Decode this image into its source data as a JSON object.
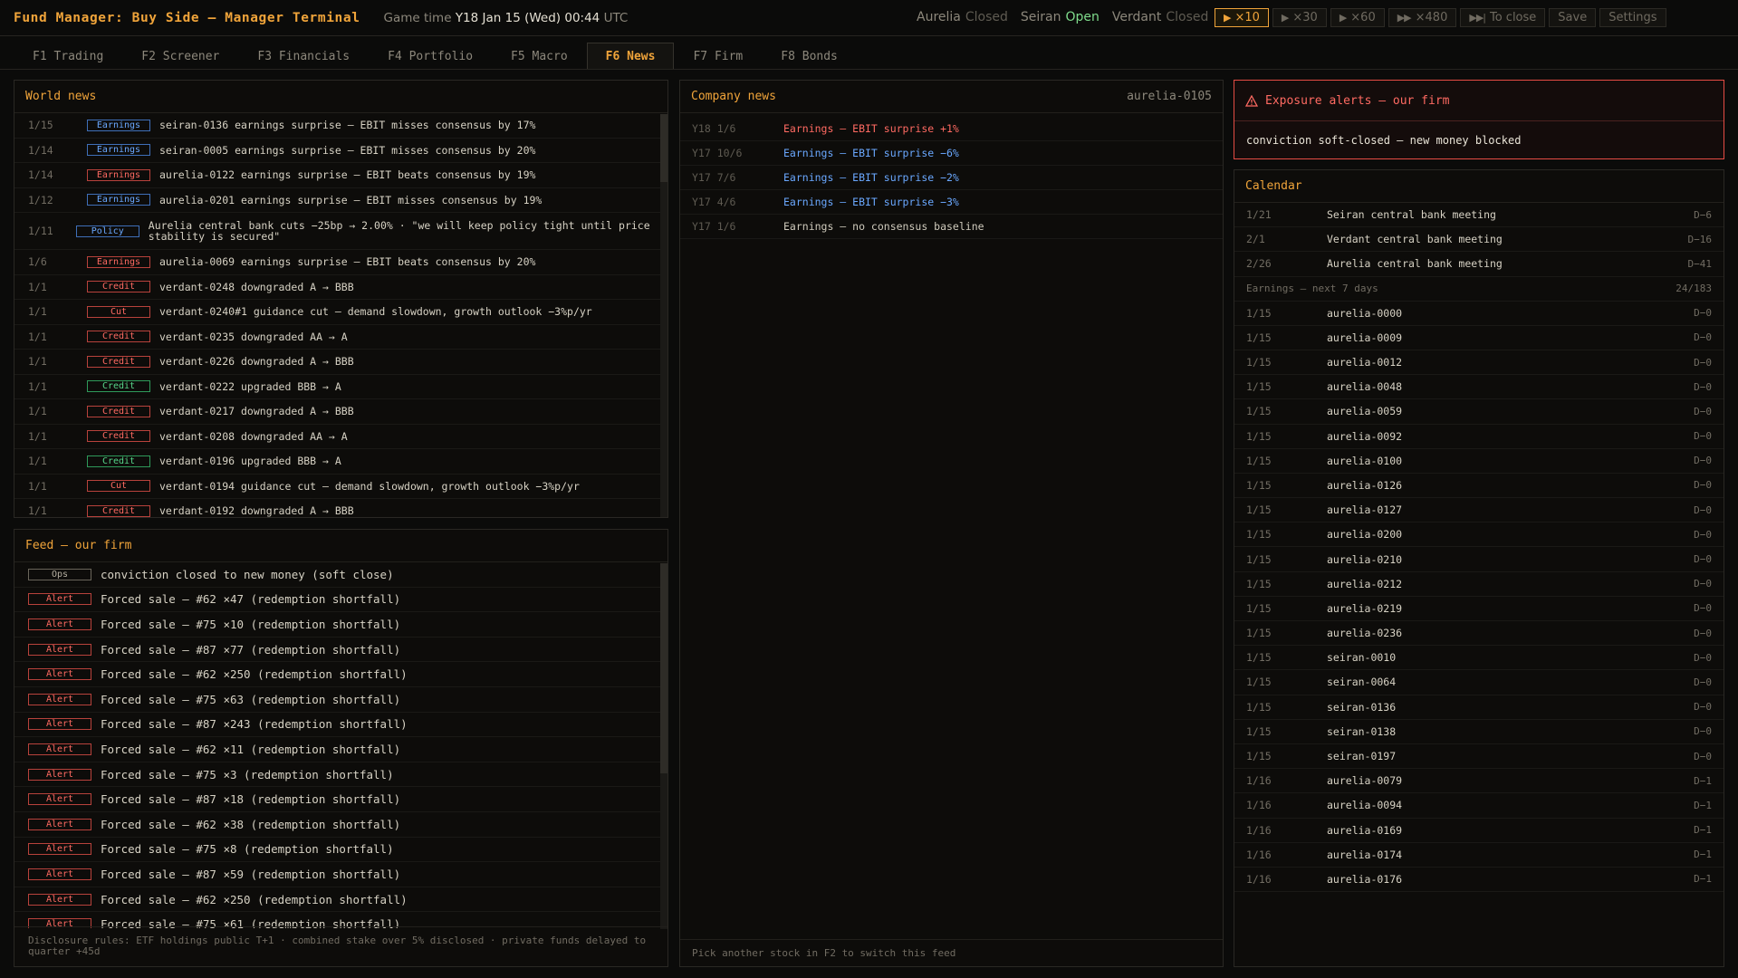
{
  "app": {
    "title": "Fund Manager: Buy Side — Manager Terminal"
  },
  "clock": {
    "label": "Game time",
    "value": "Y18 Jan 15 (Wed) 00:44",
    "tz": "UTC"
  },
  "markets": [
    {
      "name": "Aurelia",
      "status": "Closed",
      "state": "closed"
    },
    {
      "name": "Seiran",
      "status": "Open",
      "state": "open"
    },
    {
      "name": "Verdant",
      "status": "Closed",
      "state": "closed"
    }
  ],
  "speed": [
    {
      "icon": "play-icon",
      "glyph": "▶",
      "label": "×10",
      "active": true
    },
    {
      "icon": "play-icon",
      "glyph": "▶",
      "label": "×30",
      "active": false
    },
    {
      "icon": "play-icon",
      "glyph": "▶",
      "label": "×60",
      "active": false
    },
    {
      "icon": "fast-forward-icon",
      "glyph": "▶▶",
      "label": "×480",
      "active": false
    },
    {
      "icon": "skip-to-end-icon",
      "glyph": "▶▶|",
      "label": "To close",
      "active": false
    }
  ],
  "toolbar": {
    "save": "Save",
    "settings": "Settings"
  },
  "tabs": [
    {
      "key": "trading",
      "label": "F1 Trading",
      "active": false
    },
    {
      "key": "screener",
      "label": "F2 Screener",
      "active": false
    },
    {
      "key": "financials",
      "label": "F3 Financials",
      "active": false
    },
    {
      "key": "portfolio",
      "label": "F4 Portfolio",
      "active": false
    },
    {
      "key": "macro",
      "label": "F5 Macro",
      "active": false
    },
    {
      "key": "news",
      "label": "F6 News",
      "active": true
    },
    {
      "key": "firm",
      "label": "F7 Firm",
      "active": false
    },
    {
      "key": "bonds",
      "label": "F8 Bonds",
      "active": false
    }
  ],
  "world_news": {
    "title": "World news",
    "items": [
      {
        "date": "1/15",
        "tag": "Earnings",
        "tone": "earn",
        "text": "seiran-0136 earnings surprise — EBIT misses consensus by 17%"
      },
      {
        "date": "1/14",
        "tag": "Earnings",
        "tone": "earn",
        "text": "seiran-0005 earnings surprise — EBIT misses consensus by 20%"
      },
      {
        "date": "1/14",
        "tag": "Earnings",
        "tone": "earn-r",
        "text": "aurelia-0122 earnings surprise — EBIT beats consensus by 19%"
      },
      {
        "date": "1/12",
        "tag": "Earnings",
        "tone": "earn",
        "text": "aurelia-0201 earnings surprise — EBIT misses consensus by 19%"
      },
      {
        "date": "1/11",
        "tag": "Policy",
        "tone": "policy",
        "text": "Aurelia central bank cuts −25bp → 2.00% · \"we will keep policy tight until price stability is secured\"",
        "tall": true
      },
      {
        "date": "1/6",
        "tag": "Earnings",
        "tone": "earn-r",
        "text": "aurelia-0069 earnings surprise — EBIT beats consensus by 20%"
      },
      {
        "date": "1/1",
        "tag": "Credit",
        "tone": "credit-r",
        "text": "verdant-0248 downgraded A → BBB"
      },
      {
        "date": "1/1",
        "tag": "Cut",
        "tone": "cut",
        "text": "verdant-0240#1 guidance cut — demand slowdown, growth outlook −3%p/yr"
      },
      {
        "date": "1/1",
        "tag": "Credit",
        "tone": "credit-r",
        "text": "verdant-0235 downgraded AA → A"
      },
      {
        "date": "1/1",
        "tag": "Credit",
        "tone": "credit-r",
        "text": "verdant-0226 downgraded A → BBB"
      },
      {
        "date": "1/1",
        "tag": "Credit",
        "tone": "credit-g",
        "text": "verdant-0222 upgraded BBB → A"
      },
      {
        "date": "1/1",
        "tag": "Credit",
        "tone": "credit-r",
        "text": "verdant-0217 downgraded A → BBB"
      },
      {
        "date": "1/1",
        "tag": "Credit",
        "tone": "credit-r",
        "text": "verdant-0208 downgraded AA → A"
      },
      {
        "date": "1/1",
        "tag": "Credit",
        "tone": "credit-g",
        "text": "verdant-0196 upgraded BBB → A"
      },
      {
        "date": "1/1",
        "tag": "Cut",
        "tone": "cut",
        "text": "verdant-0194 guidance cut — demand slowdown, growth outlook −3%p/yr"
      },
      {
        "date": "1/1",
        "tag": "Credit",
        "tone": "credit-r",
        "text": "verdant-0192 downgraded A → BBB"
      }
    ]
  },
  "feed": {
    "title": "Feed — our firm",
    "items": [
      {
        "tag": "Ops",
        "tone": "ops",
        "text": "conviction closed to new money (soft close)"
      },
      {
        "tag": "Alert",
        "tone": "alert",
        "text": "Forced sale — #62 ×47 (redemption shortfall)"
      },
      {
        "tag": "Alert",
        "tone": "alert",
        "text": "Forced sale — #75 ×10 (redemption shortfall)"
      },
      {
        "tag": "Alert",
        "tone": "alert",
        "text": "Forced sale — #87 ×77 (redemption shortfall)"
      },
      {
        "tag": "Alert",
        "tone": "alert",
        "text": "Forced sale — #62 ×250 (redemption shortfall)"
      },
      {
        "tag": "Alert",
        "tone": "alert",
        "text": "Forced sale — #75 ×63 (redemption shortfall)"
      },
      {
        "tag": "Alert",
        "tone": "alert",
        "text": "Forced sale — #87 ×243 (redemption shortfall)"
      },
      {
        "tag": "Alert",
        "tone": "alert",
        "text": "Forced sale — #62 ×11 (redemption shortfall)"
      },
      {
        "tag": "Alert",
        "tone": "alert",
        "text": "Forced sale — #75 ×3 (redemption shortfall)"
      },
      {
        "tag": "Alert",
        "tone": "alert",
        "text": "Forced sale — #87 ×18 (redemption shortfall)"
      },
      {
        "tag": "Alert",
        "tone": "alert",
        "text": "Forced sale — #62 ×38 (redemption shortfall)"
      },
      {
        "tag": "Alert",
        "tone": "alert",
        "text": "Forced sale — #75 ×8 (redemption shortfall)"
      },
      {
        "tag": "Alert",
        "tone": "alert",
        "text": "Forced sale — #87 ×59 (redemption shortfall)"
      },
      {
        "tag": "Alert",
        "tone": "alert",
        "text": "Forced sale — #62 ×250 (redemption shortfall)"
      },
      {
        "tag": "Alert",
        "tone": "alert",
        "text": "Forced sale — #75 ×61 (redemption shortfall)"
      }
    ],
    "disclosure": "Disclosure rules: ETF holdings public T+1 · combined stake over 5% disclosed · private funds delayed to quarter +45d"
  },
  "company_news": {
    "title": "Company news",
    "ticker": "aurelia-0105",
    "items": [
      {
        "date": "Y18 1/6",
        "text": "Earnings — EBIT surprise +1%",
        "tone": "red"
      },
      {
        "date": "Y17 10/6",
        "text": "Earnings — EBIT surprise −6%",
        "tone": "blue"
      },
      {
        "date": "Y17 7/6",
        "text": "Earnings — EBIT surprise −2%",
        "tone": "blue"
      },
      {
        "date": "Y17 4/6",
        "text": "Earnings — EBIT surprise −3%",
        "tone": "blue"
      },
      {
        "date": "Y17 1/6",
        "text": "Earnings — no consensus baseline",
        "tone": "grey"
      }
    ],
    "footer": "Pick another stock in F2 to switch this feed"
  },
  "alerts": {
    "title": "Exposure alerts — our firm",
    "icon": "warning-icon",
    "message": "conviction soft-closed — new money blocked"
  },
  "calendar": {
    "title": "Calendar",
    "events": [
      {
        "date": "1/21",
        "name": "Seiran central bank meeting",
        "days": "D−6"
      },
      {
        "date": "2/1",
        "name": "Verdant central bank meeting",
        "days": "D−16"
      },
      {
        "date": "2/26",
        "name": "Aurelia central bank meeting",
        "days": "D−41"
      }
    ],
    "earnings_label": "Earnings — next 7 days",
    "earnings_count": "24/183",
    "earnings": [
      {
        "date": "1/15",
        "name": "aurelia-0000",
        "days": "D−0"
      },
      {
        "date": "1/15",
        "name": "aurelia-0009",
        "days": "D−0"
      },
      {
        "date": "1/15",
        "name": "aurelia-0012",
        "days": "D−0"
      },
      {
        "date": "1/15",
        "name": "aurelia-0048",
        "days": "D−0"
      },
      {
        "date": "1/15",
        "name": "aurelia-0059",
        "days": "D−0"
      },
      {
        "date": "1/15",
        "name": "aurelia-0092",
        "days": "D−0"
      },
      {
        "date": "1/15",
        "name": "aurelia-0100",
        "days": "D−0"
      },
      {
        "date": "1/15",
        "name": "aurelia-0126",
        "days": "D−0"
      },
      {
        "date": "1/15",
        "name": "aurelia-0127",
        "days": "D−0"
      },
      {
        "date": "1/15",
        "name": "aurelia-0200",
        "days": "D−0"
      },
      {
        "date": "1/15",
        "name": "aurelia-0210",
        "days": "D−0"
      },
      {
        "date": "1/15",
        "name": "aurelia-0212",
        "days": "D−0"
      },
      {
        "date": "1/15",
        "name": "aurelia-0219",
        "days": "D−0"
      },
      {
        "date": "1/15",
        "name": "aurelia-0236",
        "days": "D−0"
      },
      {
        "date": "1/15",
        "name": "seiran-0010",
        "days": "D−0"
      },
      {
        "date": "1/15",
        "name": "seiran-0064",
        "days": "D−0"
      },
      {
        "date": "1/15",
        "name": "seiran-0136",
        "days": "D−0"
      },
      {
        "date": "1/15",
        "name": "seiran-0138",
        "days": "D−0"
      },
      {
        "date": "1/15",
        "name": "seiran-0197",
        "days": "D−0"
      },
      {
        "date": "1/16",
        "name": "aurelia-0079",
        "days": "D−1"
      },
      {
        "date": "1/16",
        "name": "aurelia-0094",
        "days": "D−1"
      },
      {
        "date": "1/16",
        "name": "aurelia-0169",
        "days": "D−1"
      },
      {
        "date": "1/16",
        "name": "aurelia-0174",
        "days": "D−1"
      },
      {
        "date": "1/16",
        "name": "aurelia-0176",
        "days": "D−1"
      }
    ]
  },
  "colors": {
    "accent": "#f0a43a",
    "alert": "#ff6a62",
    "up": "#57d68a",
    "down_blue": "#6aa8ff",
    "open": "#7fdc8c"
  }
}
